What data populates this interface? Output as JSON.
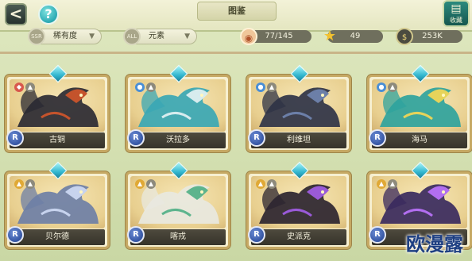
{
  "header": {
    "back_glyph": "<",
    "help_glyph": "?",
    "title": "图鉴",
    "collection_label": "收藏"
  },
  "filters": {
    "rarity_label": "稀有度",
    "element_label": "元素",
    "rarity_icon": "SSR",
    "element_icon": "ALL"
  },
  "stats": {
    "eggs": "77/145",
    "stars": "49",
    "coins": "253K"
  },
  "cards": [
    {
      "name": "古铜",
      "rarity": "R",
      "elements": [
        "fire",
        "dark"
      ],
      "color": "#2b2a33",
      "accent": "#c4532c"
    },
    {
      "name": "沃拉多",
      "rarity": "R",
      "elements": [
        "water",
        "dark"
      ],
      "color": "#3aa7b4",
      "accent": "#d7ecee"
    },
    {
      "name": "利维坦",
      "rarity": "R",
      "elements": [
        "water",
        "dark"
      ],
      "color": "#2f3346",
      "accent": "#6c7fa8"
    },
    {
      "name": "海马",
      "rarity": "R",
      "elements": [
        "water",
        "dark"
      ],
      "color": "#2fa39d",
      "accent": "#e6d35a"
    },
    {
      "name": "贝尔德",
      "rarity": "R",
      "elements": [
        "light",
        "dark"
      ],
      "color": "#6e7fa6",
      "accent": "#c7d3ee"
    },
    {
      "name": "喀戎",
      "rarity": "R",
      "elements": [
        "light",
        "dark"
      ],
      "color": "#e8e8e0",
      "accent": "#5db48d"
    },
    {
      "name": "史派克",
      "rarity": "R",
      "elements": [
        "light",
        "dark"
      ],
      "color": "#2c2530",
      "accent": "#9a5ad8"
    },
    {
      "name": "",
      "rarity": "R",
      "elements": [
        "light",
        "dark"
      ],
      "color": "#3a2a5e",
      "accent": "#b26ef0"
    }
  ],
  "watermark": "欧漫露",
  "colors": {
    "frame": "#c6a964",
    "nameplate": "#3f3b31",
    "rarity_badge": "#3a5bb0",
    "gem": "#32b7cf"
  }
}
